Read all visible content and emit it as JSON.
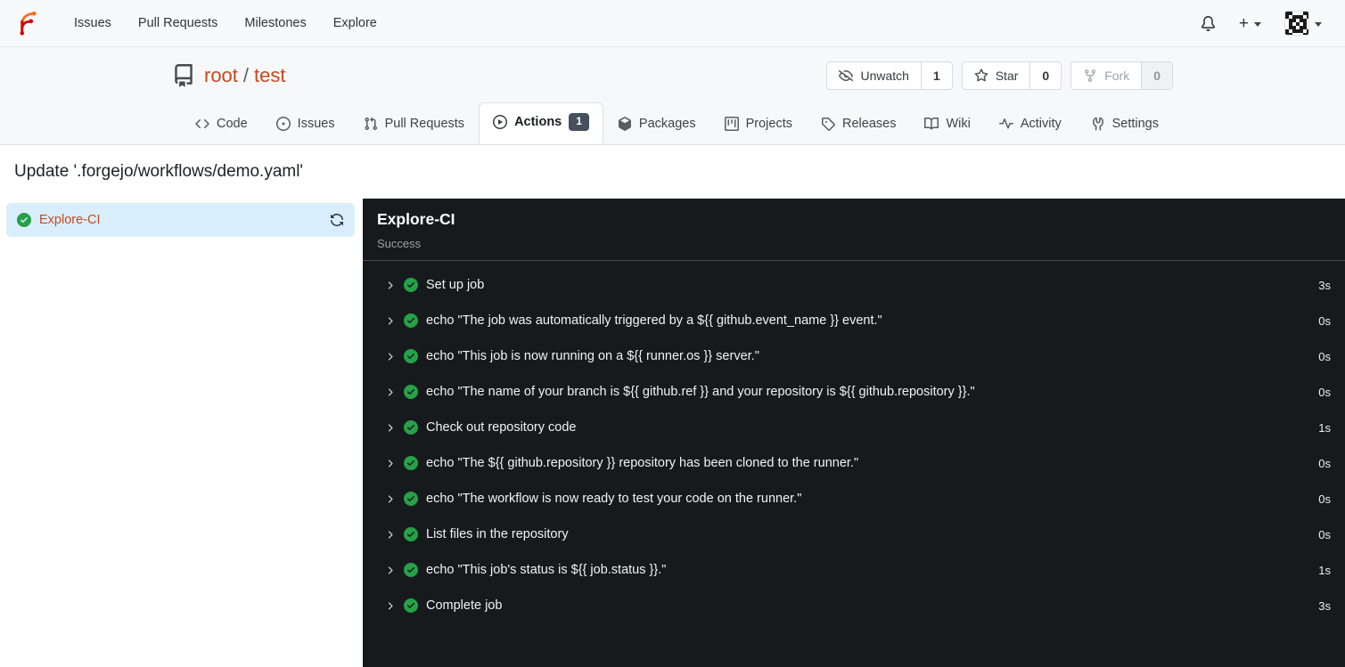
{
  "colors": {
    "primary": "#c8481d",
    "green": "#26a148",
    "panel-bg": "#171a1c",
    "badge-bg": "#454f5d",
    "selected-bg": "#d9eefb"
  },
  "nav": {
    "items": [
      "Issues",
      "Pull Requests",
      "Milestones",
      "Explore"
    ],
    "icons": [
      "bell-icon",
      "plus-icon",
      "avatar"
    ]
  },
  "repo": {
    "owner": "root",
    "separator": "/",
    "name": "test",
    "buttons": [
      {
        "label": "Unwatch",
        "count": "1"
      },
      {
        "label": "Star",
        "count": "0"
      },
      {
        "label": "Fork",
        "count": "0",
        "disabled": true
      }
    ],
    "tabs": [
      {
        "label": "Code"
      },
      {
        "label": "Issues"
      },
      {
        "label": "Pull Requests"
      },
      {
        "label": "Actions",
        "badge": "1",
        "active": true
      },
      {
        "label": "Packages"
      },
      {
        "label": "Projects"
      },
      {
        "label": "Releases"
      },
      {
        "label": "Wiki"
      },
      {
        "label": "Activity"
      },
      {
        "label": "Settings"
      }
    ]
  },
  "run": {
    "title": "Update '.forgejo/workflows/demo.yaml'",
    "job": {
      "name": "Explore-CI",
      "status": "success"
    }
  },
  "panel": {
    "title": "Explore-CI",
    "status_text": "Success",
    "steps": [
      {
        "name": "Set up job",
        "duration": "3s"
      },
      {
        "name": "echo \"The job was automatically triggered by a ${{ github.event_name }} event.\"",
        "duration": "0s"
      },
      {
        "name": "echo \"This job is now running on a ${{ runner.os }} server.\"",
        "duration": "0s"
      },
      {
        "name": "echo \"The name of your branch is ${{ github.ref }} and your repository is ${{ github.repository }}.\"",
        "duration": "0s"
      },
      {
        "name": "Check out repository code",
        "duration": "1s"
      },
      {
        "name": "echo \"The ${{ github.repository }} repository has been cloned to the runner.\"",
        "duration": "0s"
      },
      {
        "name": "echo \"The workflow is now ready to test your code on the runner.\"",
        "duration": "0s"
      },
      {
        "name": "List files in the repository",
        "duration": "0s"
      },
      {
        "name": "echo \"This job's status is ${{ job.status }}.\"",
        "duration": "1s"
      },
      {
        "name": "Complete job",
        "duration": "3s"
      }
    ]
  }
}
